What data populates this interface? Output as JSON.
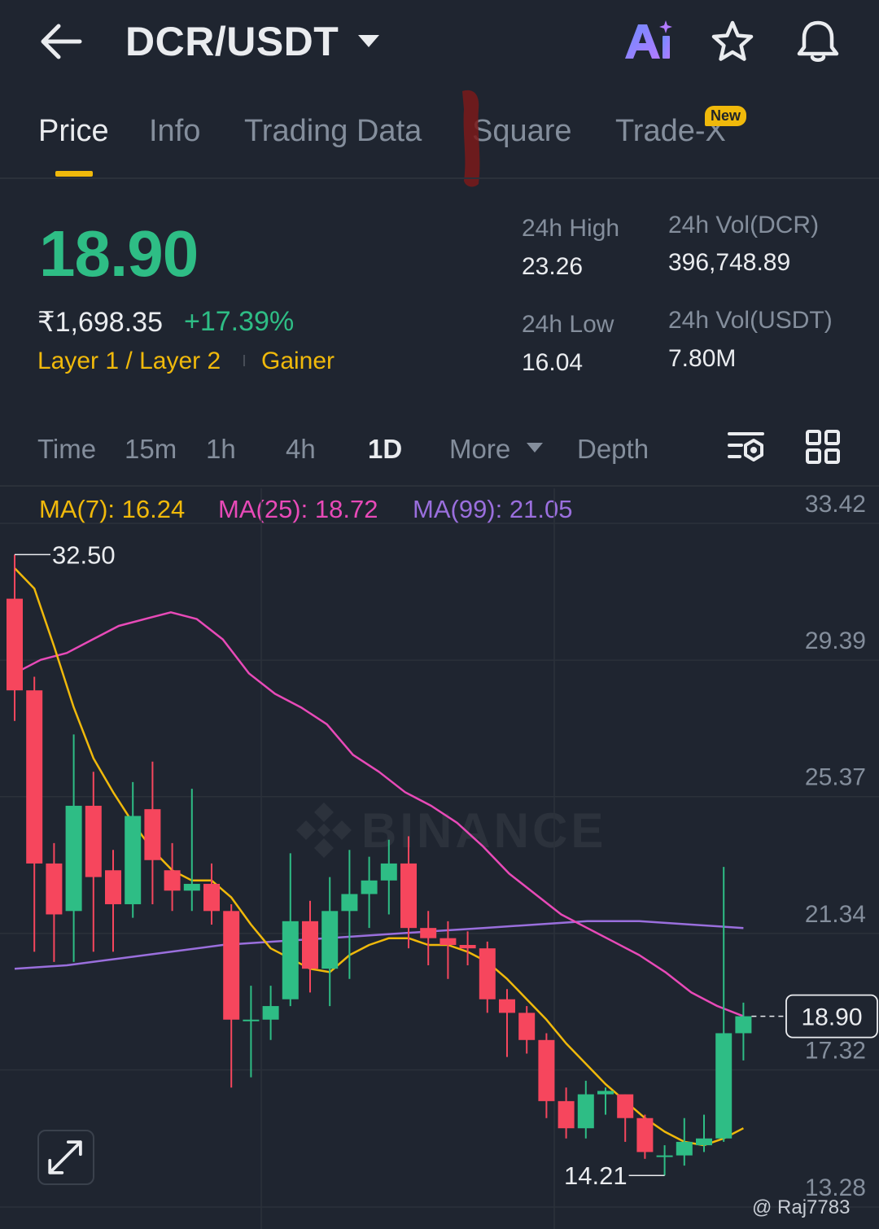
{
  "header": {
    "pair": "DCR/USDT",
    "icons": [
      "back-arrow-icon",
      "dropdown-caret-icon",
      "ai-icon",
      "star-icon",
      "bell-icon"
    ]
  },
  "tabs": [
    {
      "label": "Price",
      "active": true
    },
    {
      "label": "Info",
      "active": false
    },
    {
      "label": "Trading Data",
      "active": false
    },
    {
      "label": "Square",
      "active": false
    },
    {
      "label": "Trade-X",
      "active": false,
      "badge": "New"
    }
  ],
  "price": {
    "last": "18.90",
    "fiat": "₹1,698.35",
    "change": "+17.39%",
    "tags": [
      "Layer 1 / Layer 2",
      "Gainer"
    ]
  },
  "stats": {
    "high_label": "24h High",
    "high_value": "23.26",
    "low_label": "24h Low",
    "low_value": "16.04",
    "vol_base_label": "24h Vol(DCR)",
    "vol_base_value": "396,748.89",
    "vol_quote_label": "24h Vol(USDT)",
    "vol_quote_value": "7.80M"
  },
  "intervals": {
    "items": [
      "Time",
      "15m",
      "1h",
      "4h",
      "1D"
    ],
    "active": "1D",
    "more": "More",
    "depth": "Depth"
  },
  "ma": {
    "ma7": "MA(7): 16.24",
    "ma25": "MA(25): 18.72",
    "ma99": "MA(99): 21.05"
  },
  "colors": {
    "up": "#2ebd85",
    "down": "#f6465d",
    "accent": "#f0b90b",
    "ma7": "#f0b90b",
    "ma25": "#e84ab8",
    "ma99": "#9a6fdd"
  },
  "watermark": "BINANCE",
  "credit": "@ Raj7783",
  "chart_data": {
    "type": "candlestick",
    "y_ticks": [
      "33.42",
      "29.39",
      "25.37",
      "21.34",
      "17.32",
      "13.28"
    ],
    "ylim": [
      13.28,
      33.42
    ],
    "current_price": "18.90",
    "max_label": "32.50",
    "min_label": "14.21",
    "candles": [
      {
        "o": 31.2,
        "h": 32.5,
        "l": 27.6,
        "c": 28.5
      },
      {
        "o": 28.5,
        "h": 28.9,
        "l": 20.8,
        "c": 23.4
      },
      {
        "o": 23.4,
        "h": 24.0,
        "l": 20.5,
        "c": 21.9
      },
      {
        "o": 22.0,
        "h": 27.2,
        "l": 20.5,
        "c": 25.1
      },
      {
        "o": 25.1,
        "h": 26.1,
        "l": 20.8,
        "c": 23.0
      },
      {
        "o": 23.2,
        "h": 23.8,
        "l": 20.8,
        "c": 22.2
      },
      {
        "o": 22.2,
        "h": 25.8,
        "l": 21.8,
        "c": 24.8
      },
      {
        "o": 25.0,
        "h": 26.4,
        "l": 22.2,
        "c": 23.5
      },
      {
        "o": 23.2,
        "h": 24.0,
        "l": 22.0,
        "c": 22.6
      },
      {
        "o": 22.6,
        "h": 25.6,
        "l": 22.0,
        "c": 22.8
      },
      {
        "o": 22.8,
        "h": 23.4,
        "l": 21.6,
        "c": 22.0
      },
      {
        "o": 22.0,
        "h": 22.2,
        "l": 16.8,
        "c": 18.8
      },
      {
        "o": 18.8,
        "h": 19.8,
        "l": 17.1,
        "c": 18.8
      },
      {
        "o": 18.8,
        "h": 19.8,
        "l": 18.2,
        "c": 19.2
      },
      {
        "o": 19.4,
        "h": 23.7,
        "l": 19.2,
        "c": 21.7
      },
      {
        "o": 21.7,
        "h": 22.3,
        "l": 19.6,
        "c": 20.3
      },
      {
        "o": 20.3,
        "h": 23.0,
        "l": 19.2,
        "c": 22.0
      },
      {
        "o": 22.0,
        "h": 23.8,
        "l": 20.0,
        "c": 22.5
      },
      {
        "o": 22.5,
        "h": 23.6,
        "l": 21.5,
        "c": 22.9
      },
      {
        "o": 22.9,
        "h": 24.1,
        "l": 21.9,
        "c": 23.4
      },
      {
        "o": 23.4,
        "h": 24.2,
        "l": 20.9,
        "c": 21.5
      },
      {
        "o": 21.5,
        "h": 22.0,
        "l": 20.4,
        "c": 21.2
      },
      {
        "o": 21.2,
        "h": 21.7,
        "l": 20.0,
        "c": 21.0
      },
      {
        "o": 21.0,
        "h": 21.4,
        "l": 20.4,
        "c": 20.9
      },
      {
        "o": 20.9,
        "h": 21.1,
        "l": 19.0,
        "c": 19.4
      },
      {
        "o": 19.4,
        "h": 19.7,
        "l": 17.7,
        "c": 19.0
      },
      {
        "o": 19.0,
        "h": 19.2,
        "l": 17.8,
        "c": 18.2
      },
      {
        "o": 18.2,
        "h": 18.4,
        "l": 15.9,
        "c": 16.4
      },
      {
        "o": 16.4,
        "h": 16.8,
        "l": 15.3,
        "c": 15.6
      },
      {
        "o": 15.6,
        "h": 17.0,
        "l": 15.3,
        "c": 16.6
      },
      {
        "o": 16.6,
        "h": 16.8,
        "l": 16.0,
        "c": 16.7
      },
      {
        "o": 16.6,
        "h": 16.6,
        "l": 15.2,
        "c": 15.9
      },
      {
        "o": 15.9,
        "h": 16.0,
        "l": 14.7,
        "c": 14.9
      },
      {
        "o": 14.8,
        "h": 15.1,
        "l": 14.21,
        "c": 14.8
      },
      {
        "o": 14.8,
        "h": 15.9,
        "l": 14.5,
        "c": 15.2
      },
      {
        "o": 15.1,
        "h": 16.0,
        "l": 14.9,
        "c": 15.3
      },
      {
        "o": 15.3,
        "h": 23.3,
        "l": 15.2,
        "c": 18.4
      },
      {
        "o": 18.4,
        "h": 19.3,
        "l": 17.6,
        "c": 18.9
      }
    ],
    "ma7": [
      32.1,
      31.5,
      29.8,
      28.0,
      26.5,
      25.5,
      24.6,
      23.8,
      23.2,
      22.9,
      22.9,
      22.4,
      21.6,
      20.9,
      20.6,
      20.3,
      20.2,
      20.7,
      21.0,
      21.2,
      21.2,
      21.0,
      21.0,
      20.8,
      20.5,
      20.0,
      19.4,
      18.8,
      18.1,
      17.5,
      16.9,
      16.4,
      15.9,
      15.5,
      15.2,
      15.1,
      15.3,
      15.6
    ],
    "ma25": [
      29.0,
      29.4,
      29.6,
      30.0,
      30.4,
      30.6,
      30.8,
      30.6,
      30.0,
      29.0,
      28.4,
      28.0,
      27.5,
      26.6,
      26.1,
      25.5,
      25.1,
      24.6,
      23.9,
      23.1,
      22.5,
      21.9,
      21.5,
      21.1,
      20.7,
      20.2,
      19.6,
      19.2,
      18.9
    ],
    "ma99": [
      20.3,
      20.4,
      20.6,
      20.8,
      21.0,
      21.1,
      21.2,
      21.3,
      21.4,
      21.5,
      21.6,
      21.7,
      21.7,
      21.6,
      21.5
    ]
  }
}
